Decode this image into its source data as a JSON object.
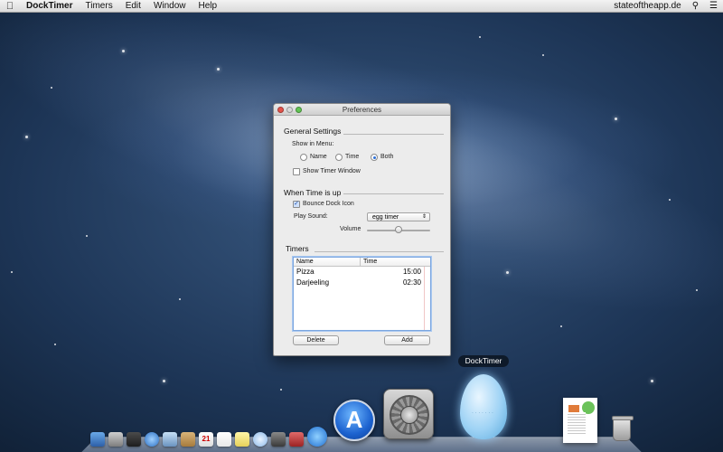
{
  "menubar": {
    "app_name": "DockTimer",
    "menus": [
      "Timers",
      "Edit",
      "Window",
      "Help"
    ],
    "right_label": "stateoftheapp.de"
  },
  "window": {
    "title": "Preferences",
    "general": {
      "title": "General Settings",
      "show_in_menu_label": "Show in Menu:",
      "options": [
        "Name",
        "Time",
        "Both"
      ],
      "selected": "Both",
      "show_timer_window_label": "Show Timer Window",
      "show_timer_window_checked": false
    },
    "when_time_up": {
      "title": "When Time is up",
      "bounce_label": "Bounce Dock Icon",
      "bounce_checked": true,
      "play_sound_label": "Play Sound:",
      "sound_value": "egg timer",
      "volume_label": "Volume",
      "volume_level": 0.5
    },
    "timers": {
      "title": "Timers",
      "columns": [
        "Name",
        "Time"
      ],
      "rows": [
        {
          "name": "Pizza",
          "time": "15:00"
        },
        {
          "name": "Darjeeling",
          "time": "02:30"
        }
      ],
      "delete_label": "Delete",
      "add_label": "Add"
    }
  },
  "dock": {
    "tooltip": "DockTimer"
  }
}
